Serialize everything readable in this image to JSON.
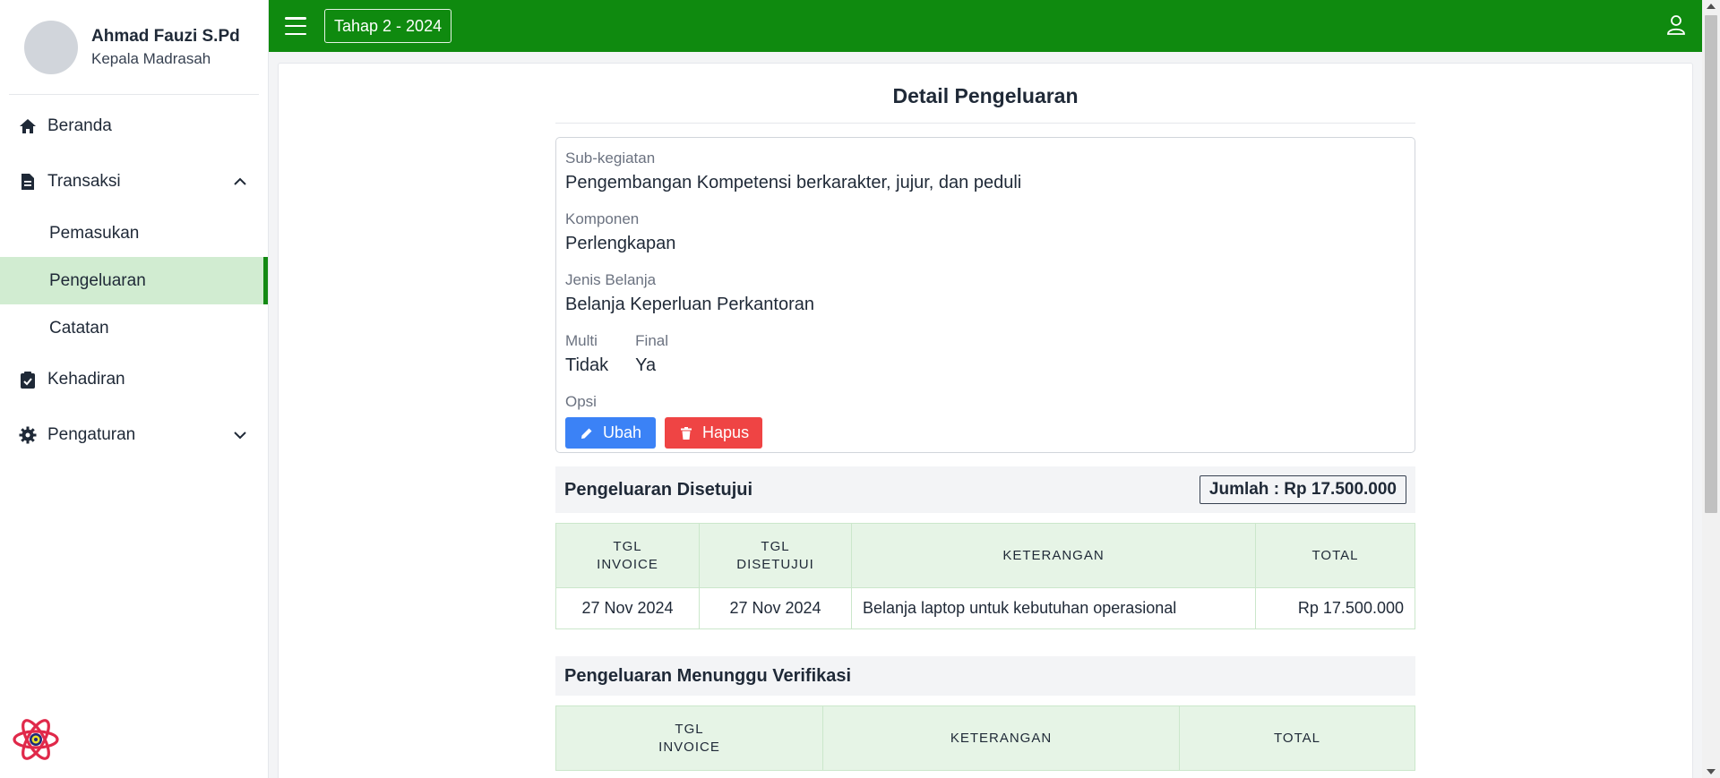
{
  "profile": {
    "name": "Ahmad Fauzi S.Pd",
    "role": "Kepala Madrasah"
  },
  "sidebar": {
    "items": [
      {
        "label": "Beranda",
        "icon": "home-icon"
      },
      {
        "label": "Transaksi",
        "icon": "document-icon",
        "expanded": true,
        "children": [
          "Pemasukan",
          "Pengeluaran",
          "Catatan"
        ]
      },
      {
        "label": "Kehadiran",
        "icon": "clipboard-check-icon"
      },
      {
        "label": "Pengaturan",
        "icon": "gear-icon",
        "expanded": false
      }
    ],
    "active_child": "Pengeluaran"
  },
  "topbar": {
    "period": "Tahap 2 - 2024",
    "accent": "#0f8a0f"
  },
  "page": {
    "title": "Detail Pengeluaran",
    "fields": {
      "subkegiatan_label": "Sub-kegiatan",
      "subkegiatan_value": "Pengembangan Kompetensi berkarakter, jujur, dan peduli",
      "komponen_label": "Komponen",
      "komponen_value": "Perlengkapan",
      "jenis_label": "Jenis Belanja",
      "jenis_value": "Belanja Keperluan Perkantoran",
      "multi_label": "Multi",
      "multi_value": "Tidak",
      "final_label": "Final",
      "final_value": "Ya",
      "opsi_label": "Opsi"
    },
    "buttons": {
      "edit": "Ubah",
      "delete": "Hapus"
    },
    "approved": {
      "title": "Pengeluaran Disetujui",
      "total_text": "Jumlah : Rp 17.500.000",
      "headers": {
        "tgl_invoice_1": "TGL",
        "tgl_invoice_2": "INVOICE",
        "tgl_setuju_1": "TGL",
        "tgl_setuju_2": "DISETUJUI",
        "keterangan": "KETERANGAN",
        "total": "TOTAL"
      },
      "rows": [
        {
          "tgl_invoice": "27 Nov 2024",
          "tgl_disetujui": "27 Nov 2024",
          "keterangan": "Belanja laptop untuk kebutuhan operasional",
          "total": "Rp 17.500.000"
        }
      ]
    },
    "pending": {
      "title": "Pengeluaran Menunggu Verifikasi",
      "headers": {
        "tgl_invoice_1": "TGL",
        "tgl_invoice_2": "INVOICE",
        "keterangan": "KETERANGAN",
        "total": "TOTAL"
      }
    }
  }
}
